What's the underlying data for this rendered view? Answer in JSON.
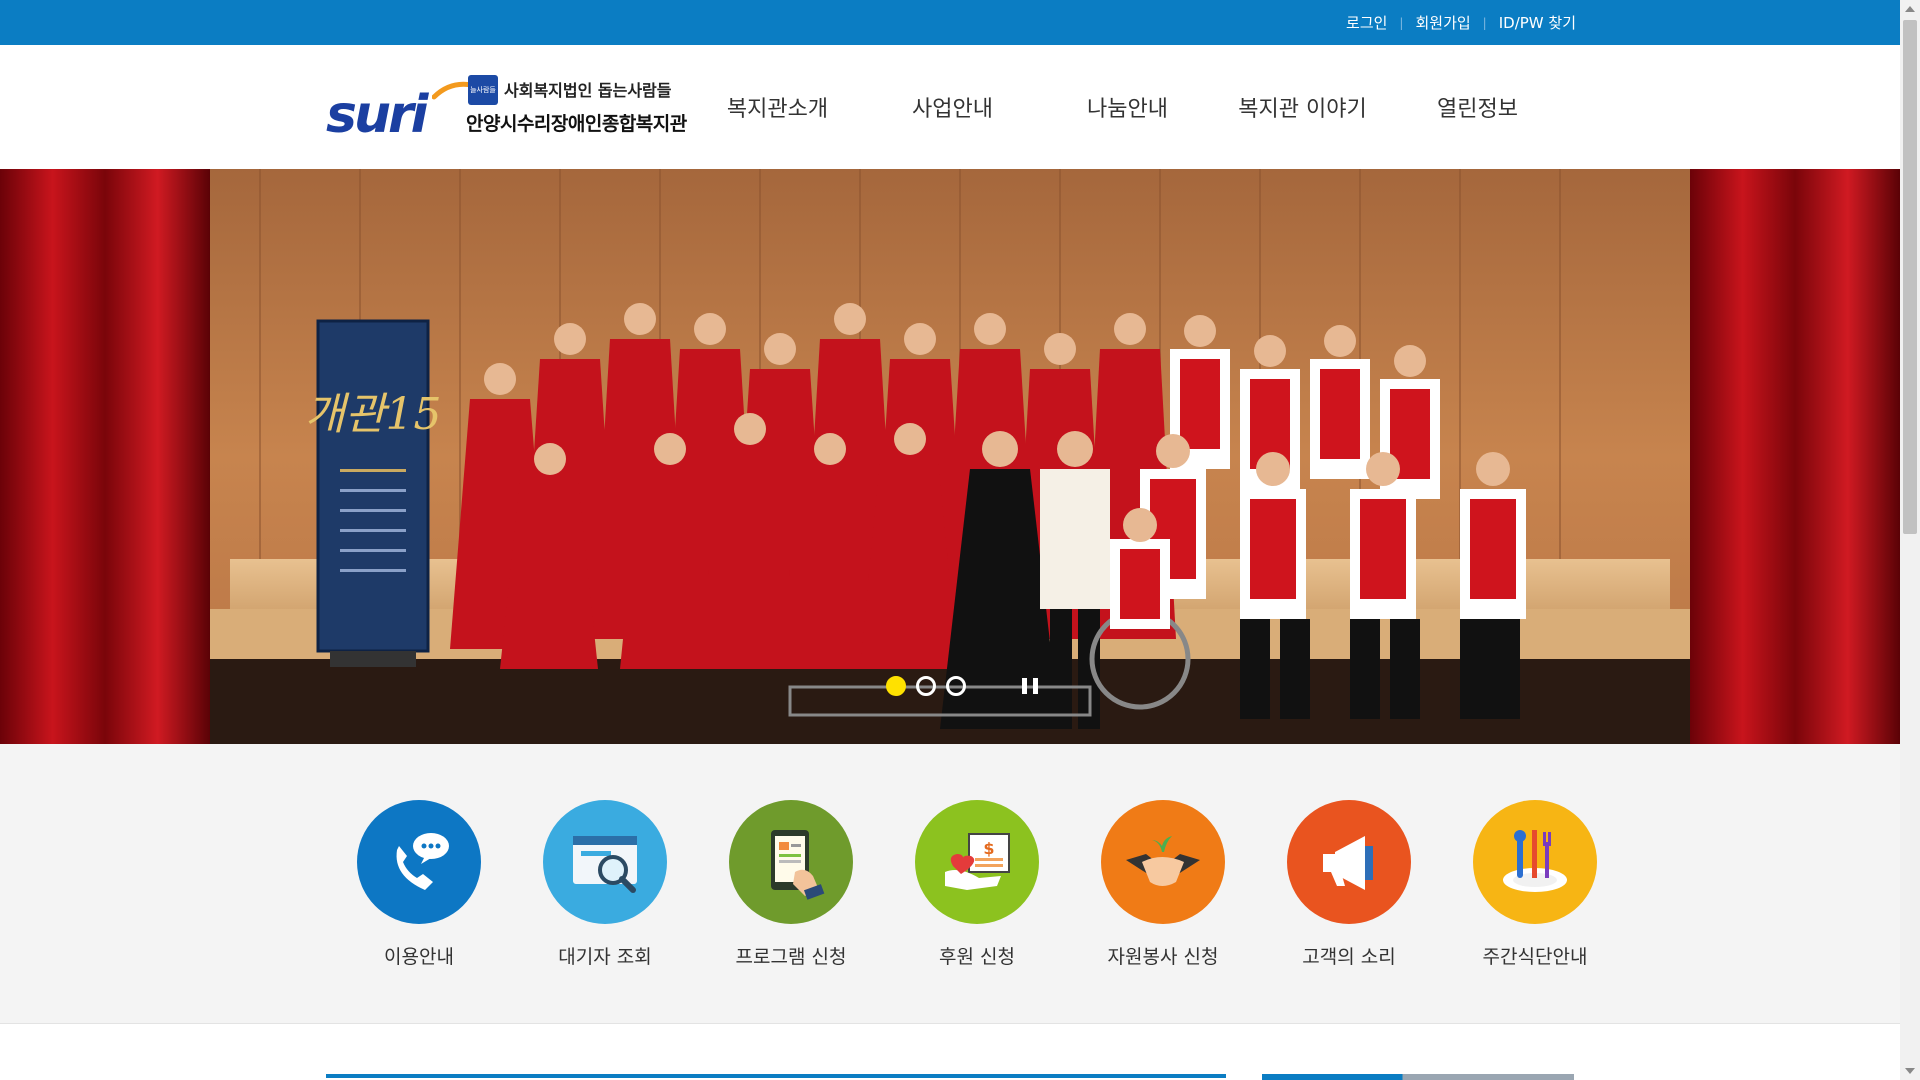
{
  "utility": {
    "login": "로그인",
    "join": "회원가입",
    "find": "ID/PW 찾기"
  },
  "logo": {
    "mark": "suri",
    "small_badge": "늘사람들",
    "org": "사회복지법인 돕는사람들",
    "name": "안양시수리장애인종합복지관"
  },
  "nav": [
    {
      "label": "복지관소개"
    },
    {
      "label": "사업안내"
    },
    {
      "label": "나눔안내"
    },
    {
      "label": "복지관 이야기"
    },
    {
      "label": "열린정보"
    }
  ],
  "hero": {
    "banner_title": "개관15",
    "slides_total": 3,
    "active_slide": 1
  },
  "quick_menu": [
    {
      "label": "이용안내",
      "color": "#0d77c4",
      "icon": "phone-chat-icon"
    },
    {
      "label": "대기자 조회",
      "color": "#3aabe0",
      "icon": "browser-search-icon"
    },
    {
      "label": "프로그램 신청",
      "color": "#6f9b2c",
      "icon": "tablet-touch-icon"
    },
    {
      "label": "후원 신청",
      "color": "#8cc21f",
      "icon": "donation-icon"
    },
    {
      "label": "자원봉사 신청",
      "color": "#f07b16",
      "icon": "handshake-icon"
    },
    {
      "label": "고객의 소리",
      "color": "#e9541f",
      "icon": "megaphone-icon"
    },
    {
      "label": "주간식단안내",
      "color": "#f7b514",
      "icon": "meal-icon"
    }
  ],
  "colors": {
    "primary": "#0b7dc3",
    "dot_active": "#ffe100"
  }
}
